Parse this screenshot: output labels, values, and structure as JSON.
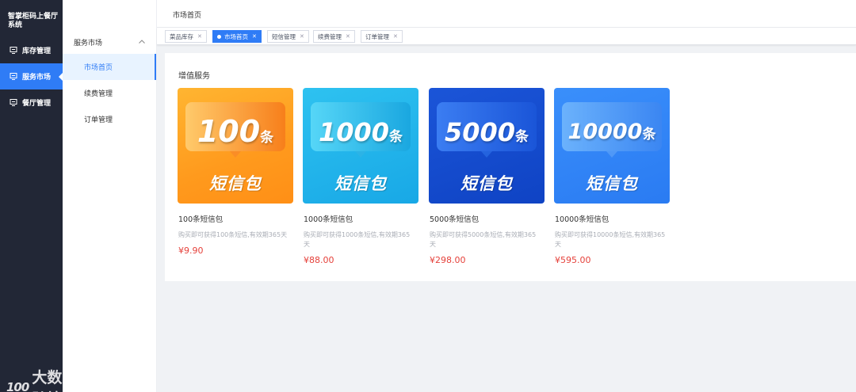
{
  "app": {
    "title": "智掌柜码上餐厅系统"
  },
  "sidebar": {
    "items": [
      {
        "label": "库存管理",
        "icon": "inventory-icon"
      },
      {
        "label": "服务市场",
        "icon": "market-icon",
        "active": true
      },
      {
        "label": "餐厅管理",
        "icon": "restaurant-icon"
      }
    ]
  },
  "subnav": {
    "group": "服务市场",
    "items": [
      {
        "label": "市场首页",
        "active": true
      },
      {
        "label": "续费管理"
      },
      {
        "label": "订单管理"
      }
    ]
  },
  "header": {
    "breadcrumb": "市场首页"
  },
  "tags": [
    {
      "label": "菜品库存"
    },
    {
      "label": "市场首页",
      "active": true
    },
    {
      "label": "短信管理"
    },
    {
      "label": "续费管理"
    },
    {
      "label": "订单管理"
    }
  ],
  "main": {
    "section_title": "增值服务",
    "products": [
      {
        "count": "100",
        "unit": "条",
        "package": "短信包",
        "name": "100条短信包",
        "desc": "购买即可获得100条短信,有效期365天",
        "price": "¥9.90"
      },
      {
        "count": "1000",
        "unit": "条",
        "package": "短信包",
        "name": "1000条短信包",
        "desc": "购买即可获得1000条短信,有效期365天",
        "price": "¥88.00"
      },
      {
        "count": "5000",
        "unit": "条",
        "package": "短信包",
        "name": "5000条短信包",
        "desc": "购买即可获得5000条短信,有效期365天",
        "price": "¥298.00"
      },
      {
        "count": "10000",
        "unit": "条",
        "package": "短信包",
        "name": "10000条短信包",
        "desc": "购买即可获得10000条短信,有效期365天",
        "price": "¥595.00"
      }
    ]
  },
  "watermark": {
    "logo": "100",
    "text": "大数跨境"
  },
  "colors": {
    "accent": "#2f7cf6",
    "sidebar_bg": "#222736",
    "price": "#e5413b"
  }
}
